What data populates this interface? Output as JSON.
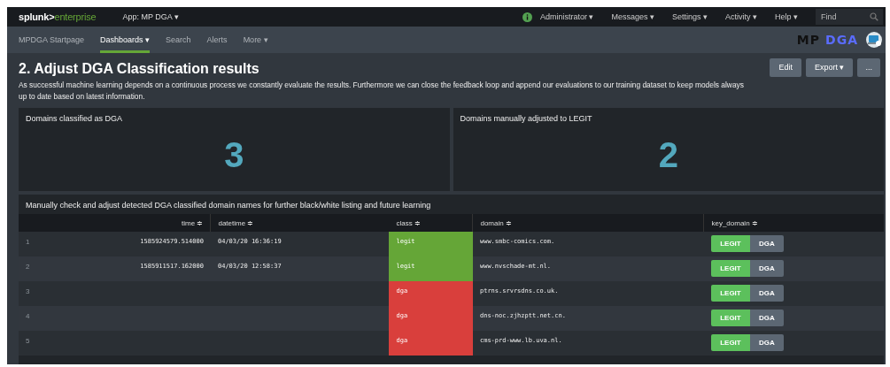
{
  "top_bar": {
    "brand_dark": "splunk>",
    "brand_light": "enterprise",
    "app_menu": "App: MP DGA ▾",
    "menus": [
      {
        "label": "Administrator ▾",
        "kind": "user"
      },
      {
        "label": "Messages ▾",
        "kind": "menu"
      },
      {
        "label": "Settings ▾",
        "kind": "menu"
      },
      {
        "label": "Activity ▾",
        "kind": "menu"
      },
      {
        "label": "Help ▾",
        "kind": "menu"
      }
    ],
    "find": {
      "placeholder": "Find"
    }
  },
  "nav": {
    "tabs": [
      {
        "label": "MPDGA Startpage",
        "selected": false
      },
      {
        "label": "Dashboards ▾",
        "selected": true
      },
      {
        "label": "Search",
        "selected": false
      },
      {
        "label": "Alerts",
        "selected": false
      },
      {
        "label": "More ▾",
        "selected": false
      }
    ],
    "logo": {
      "left": "MP",
      "right": "DGA"
    }
  },
  "dashboard": {
    "title": "2. Adjust DGA Classification results",
    "description": "As successful machine learning depends on a continuous process we constantly evaluate the results. Furthermore we can close the feedback loop and append our evaluations to our training dataset to keep models always up to date based on latest information.",
    "buttons": [
      "Edit",
      "Export ▾",
      "..."
    ]
  },
  "panels": [
    {
      "title": "Domains classified as DGA",
      "value": "3"
    },
    {
      "title": "Domains manually adjusted to LEGIT",
      "value": "2"
    }
  ],
  "table": {
    "title": "Manually check and adjust detected DGA classified domain names for further black/white listing and future learning",
    "columns": [
      "time ≑",
      "datetime ≑",
      "class ≑",
      "domain ≑",
      "key_domain ≑"
    ],
    "rows": [
      {
        "index": "1",
        "time": "1585924579.514000",
        "datetime": "04/03/20 16:36:19",
        "class": "legit",
        "color": "#65a637",
        "domain": "www.smbc-comics.com.",
        "actions": [
          "LEGIT",
          "DGA"
        ]
      },
      {
        "index": "2",
        "time": "1585911517.162000",
        "datetime": "04/03/20 12:58:37",
        "class": "legit",
        "color": "#65a637",
        "domain": "www.nvschade-mt.nl.",
        "actions": [
          "LEGIT",
          "DGA"
        ]
      },
      {
        "index": "3",
        "class": "dga",
        "color": "#d93f3c",
        "domain": "ptrns.srvrsdns.co.uk.",
        "actions": [
          "LEGIT",
          "DGA"
        ]
      },
      {
        "index": "4",
        "class": "dga",
        "color": "#d93f3c",
        "domain": "dns-noc.zjhzptt.net.cn.",
        "actions": [
          "LEGIT",
          "DGA"
        ]
      },
      {
        "index": "5",
        "class": "dga",
        "color": "#d93f3c",
        "domain": "cms-prd-www.lb.uva.nl.",
        "actions": [
          "LEGIT",
          "DGA"
        ]
      }
    ]
  }
}
